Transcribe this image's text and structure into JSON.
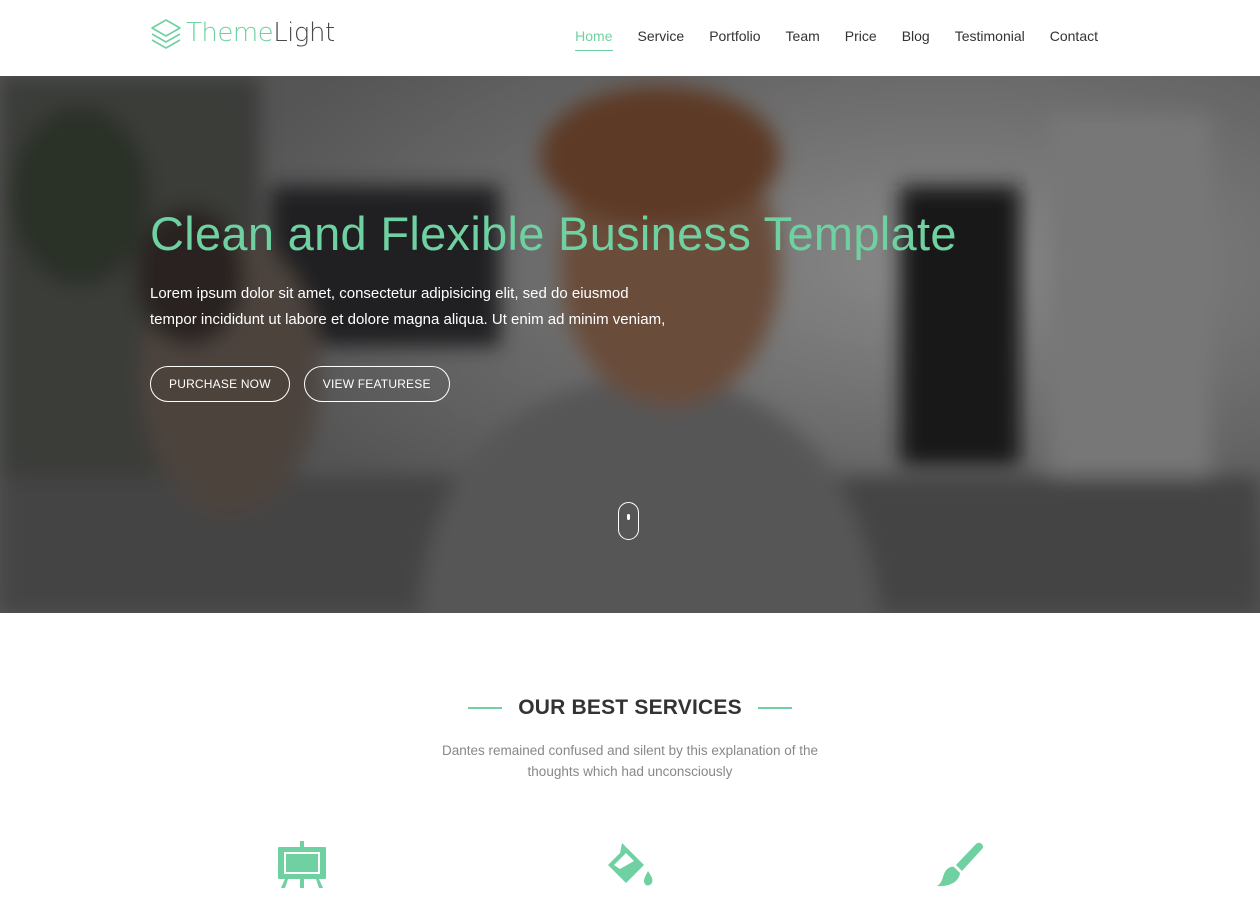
{
  "brand": {
    "part1": "Theme",
    "part2": "Light",
    "accent": "#6fd1a1"
  },
  "nav": {
    "items": [
      {
        "label": "Home",
        "active": true
      },
      {
        "label": "Service",
        "active": false
      },
      {
        "label": "Portfolio",
        "active": false
      },
      {
        "label": "Team",
        "active": false
      },
      {
        "label": "Price",
        "active": false
      },
      {
        "label": "Blog",
        "active": false
      },
      {
        "label": "Testimonial",
        "active": false
      },
      {
        "label": "Contact",
        "active": false
      }
    ]
  },
  "hero": {
    "title": "Clean and Flexible Business Template",
    "text_line1": "Lorem ipsum dolor sit amet, consectetur adipisicing elit, sed do eiusmod",
    "text_line2": "tempor incididunt ut labore et dolore magna aliqua. Ut enim ad minim veniam,",
    "primary_button": "PURCHASE NOW",
    "secondary_button": "VIEW FEATURESE"
  },
  "services": {
    "title": "OUR BEST SERVICES",
    "subtitle_line1": "Dantes remained confused and silent by this explanation of the",
    "subtitle_line2": "thoughts which had unconsciously",
    "icons": [
      "easel-icon",
      "paint-bucket-icon",
      "paintbrush-icon"
    ]
  }
}
